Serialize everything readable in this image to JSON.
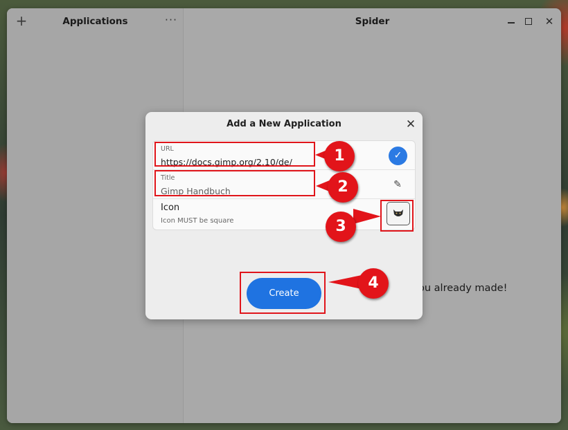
{
  "sidebar": {
    "title": "Applications",
    "add_glyph": "+",
    "more_glyph": "···"
  },
  "window": {
    "title": "Spider",
    "close_glyph": "✕"
  },
  "content": {
    "status_text": "ou already made!"
  },
  "dialog": {
    "title": "Add a New Application",
    "close_glyph": "✕",
    "url": {
      "label": "URL",
      "value": "https://docs.gimp.org/2.10/de/"
    },
    "title_field": {
      "label": "Title",
      "value": "Gimp Handbuch"
    },
    "icon_field": {
      "label": "Icon",
      "hint": "Icon MUST be square"
    },
    "check_glyph": "✓",
    "edit_glyph": "✎",
    "create_label": "Create"
  },
  "annotations": [
    "1",
    "2",
    "3",
    "4"
  ],
  "colors": {
    "accent": "#1f73e1",
    "annotation_red": "#e0141a"
  }
}
